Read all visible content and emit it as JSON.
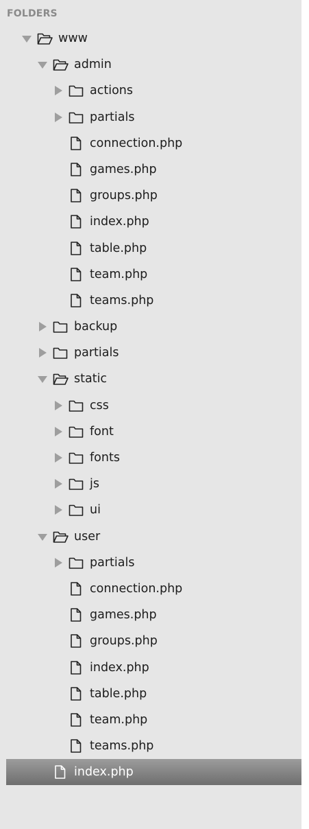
{
  "sidebar": {
    "header": "FOLDERS",
    "tree": [
      {
        "depth": 0,
        "type": "folder",
        "expanded": true,
        "label": "www",
        "slug": "www"
      },
      {
        "depth": 1,
        "type": "folder",
        "expanded": true,
        "label": "admin",
        "slug": "admin"
      },
      {
        "depth": 2,
        "type": "folder",
        "expanded": false,
        "label": "actions",
        "slug": "admin-actions"
      },
      {
        "depth": 2,
        "type": "folder",
        "expanded": false,
        "label": "partials",
        "slug": "admin-partials"
      },
      {
        "depth": 2,
        "type": "file",
        "label": "connection.php",
        "slug": "admin-connection-php"
      },
      {
        "depth": 2,
        "type": "file",
        "label": "games.php",
        "slug": "admin-games-php"
      },
      {
        "depth": 2,
        "type": "file",
        "label": "groups.php",
        "slug": "admin-groups-php"
      },
      {
        "depth": 2,
        "type": "file",
        "label": "index.php",
        "slug": "admin-index-php"
      },
      {
        "depth": 2,
        "type": "file",
        "label": "table.php",
        "slug": "admin-table-php"
      },
      {
        "depth": 2,
        "type": "file",
        "label": "team.php",
        "slug": "admin-team-php"
      },
      {
        "depth": 2,
        "type": "file",
        "label": "teams.php",
        "slug": "admin-teams-php"
      },
      {
        "depth": 1,
        "type": "folder",
        "expanded": false,
        "label": "backup",
        "slug": "backup"
      },
      {
        "depth": 1,
        "type": "folder",
        "expanded": false,
        "label": "partials",
        "slug": "partials"
      },
      {
        "depth": 1,
        "type": "folder",
        "expanded": true,
        "label": "static",
        "slug": "static"
      },
      {
        "depth": 2,
        "type": "folder",
        "expanded": false,
        "label": "css",
        "slug": "static-css"
      },
      {
        "depth": 2,
        "type": "folder",
        "expanded": false,
        "label": "font",
        "slug": "static-font"
      },
      {
        "depth": 2,
        "type": "folder",
        "expanded": false,
        "label": "fonts",
        "slug": "static-fonts"
      },
      {
        "depth": 2,
        "type": "folder",
        "expanded": false,
        "label": "js",
        "slug": "static-js"
      },
      {
        "depth": 2,
        "type": "folder",
        "expanded": false,
        "label": "ui",
        "slug": "static-ui"
      },
      {
        "depth": 1,
        "type": "folder",
        "expanded": true,
        "label": "user",
        "slug": "user"
      },
      {
        "depth": 2,
        "type": "folder",
        "expanded": false,
        "label": "partials",
        "slug": "user-partials"
      },
      {
        "depth": 2,
        "type": "file",
        "label": "connection.php",
        "slug": "user-connection-php"
      },
      {
        "depth": 2,
        "type": "file",
        "label": "games.php",
        "slug": "user-games-php"
      },
      {
        "depth": 2,
        "type": "file",
        "label": "groups.php",
        "slug": "user-groups-php"
      },
      {
        "depth": 2,
        "type": "file",
        "label": "index.php",
        "slug": "user-index-php"
      },
      {
        "depth": 2,
        "type": "file",
        "label": "table.php",
        "slug": "user-table-php"
      },
      {
        "depth": 2,
        "type": "file",
        "label": "team.php",
        "slug": "user-team-php"
      },
      {
        "depth": 2,
        "type": "file",
        "label": "teams.php",
        "slug": "user-teams-php"
      },
      {
        "depth": 1,
        "type": "file",
        "label": "index.php",
        "slug": "index-php",
        "selected": true
      }
    ]
  },
  "colors": {
    "sidebar_bg": "#e6e6e6",
    "header_text": "#8a8a8a",
    "disclosure_triangle": "#9e9e9e",
    "icon_stroke": "#222222",
    "selected_bg_top": "#9c9c9c",
    "selected_bg_bottom": "#6e6e6e",
    "selected_text": "#ffffff"
  },
  "icons": {
    "collapsed": "triangle-right-icon",
    "expanded": "triangle-down-icon",
    "folder_closed": "folder-icon",
    "folder_open": "folder-open-icon",
    "file": "file-icon"
  }
}
